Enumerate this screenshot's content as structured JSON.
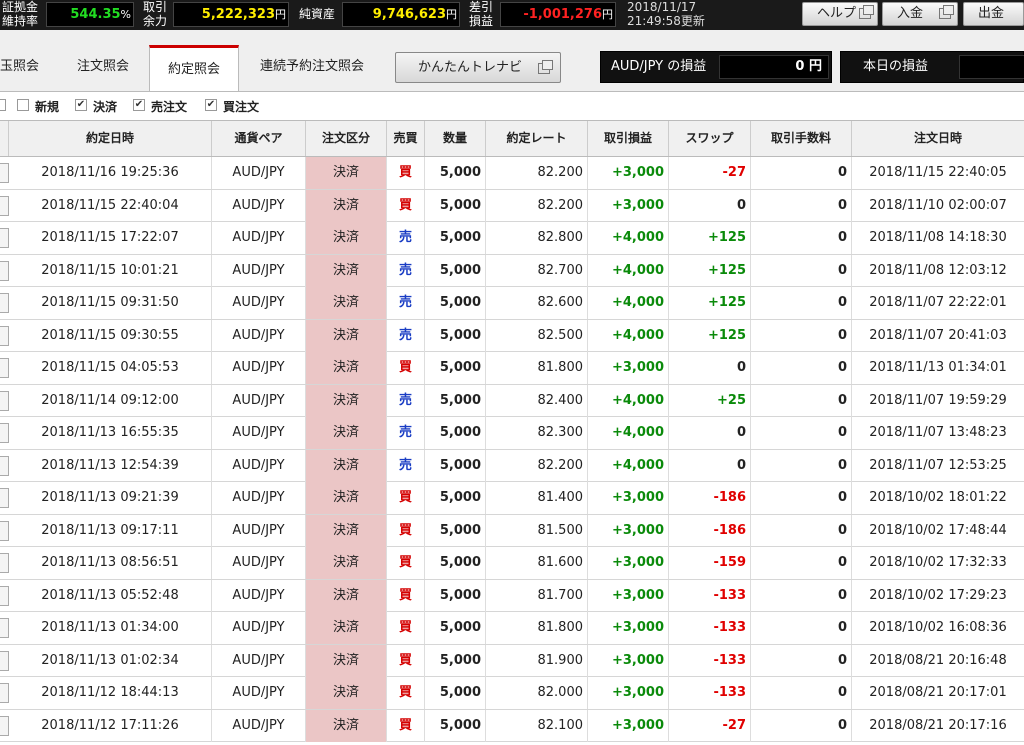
{
  "header": {
    "margin_ratio_label_1": "証拠金",
    "margin_ratio_label_2": "維持率",
    "margin_ratio_value": "544.35",
    "margin_ratio_unit": "%",
    "available_label_1": "取引",
    "available_label_2": "余力",
    "available_value": "5,222,323",
    "available_unit": "円",
    "net_assets_label": "純資産",
    "net_assets_value": "9,746,623",
    "net_assets_unit": "円",
    "diff_pl_label_1": "差引",
    "diff_pl_label_2": "損益",
    "diff_pl_value": "-1,001,276",
    "diff_pl_unit": "円",
    "updated_date": "2018/11/17",
    "updated_time": "21:49:58更新",
    "help_label": "ヘルプ",
    "deposit_label": "入金",
    "withdraw_label": "出金",
    "colors": {
      "positive": "#22dd22",
      "value": "#ffee00",
      "negative": "#ff2222"
    }
  },
  "tabs": [
    {
      "label": "玉照会",
      "active": false
    },
    {
      "label": "注文照会",
      "active": false
    },
    {
      "label": "約定照会",
      "active": true
    },
    {
      "label": "連続予約注文照会",
      "active": false
    }
  ],
  "navi_button": "かんたんトレナビ",
  "pair_pl": {
    "label": "AUD/JPY の損益",
    "value": "0 円"
  },
  "today_pl": {
    "label": "本日の損益",
    "value": ""
  },
  "filters": [
    {
      "label": "新規",
      "checked": false
    },
    {
      "label": "決済",
      "checked": true
    },
    {
      "label": "売注文",
      "checked": true
    },
    {
      "label": "買注文",
      "checked": true
    }
  ],
  "columns": [
    "約定日時",
    "通貨ペア",
    "注文区分",
    "売買",
    "数量",
    "約定レート",
    "取引損益",
    "スワップ",
    "取引手数料",
    "注文日時"
  ],
  "rows": [
    {
      "exec_time": "2018/11/16 19:25:36",
      "pair": "AUD/JPY",
      "kubun": "決済",
      "side": "買",
      "qty": "5,000",
      "rate": "82.200",
      "pl": "+3,000",
      "swap": "-27",
      "fee": "0",
      "order_time": "2018/11/15 22:40:05"
    },
    {
      "exec_time": "2018/11/15 22:40:04",
      "pair": "AUD/JPY",
      "kubun": "決済",
      "side": "買",
      "qty": "5,000",
      "rate": "82.200",
      "pl": "+3,000",
      "swap": "0",
      "fee": "0",
      "order_time": "2018/11/10 02:00:07"
    },
    {
      "exec_time": "2018/11/15 17:22:07",
      "pair": "AUD/JPY",
      "kubun": "決済",
      "side": "売",
      "qty": "5,000",
      "rate": "82.800",
      "pl": "+4,000",
      "swap": "+125",
      "fee": "0",
      "order_time": "2018/11/08 14:18:30"
    },
    {
      "exec_time": "2018/11/15 10:01:21",
      "pair": "AUD/JPY",
      "kubun": "決済",
      "side": "売",
      "qty": "5,000",
      "rate": "82.700",
      "pl": "+4,000",
      "swap": "+125",
      "fee": "0",
      "order_time": "2018/11/08 12:03:12"
    },
    {
      "exec_time": "2018/11/15 09:31:50",
      "pair": "AUD/JPY",
      "kubun": "決済",
      "side": "売",
      "qty": "5,000",
      "rate": "82.600",
      "pl": "+4,000",
      "swap": "+125",
      "fee": "0",
      "order_time": "2018/11/07 22:22:01"
    },
    {
      "exec_time": "2018/11/15 09:30:55",
      "pair": "AUD/JPY",
      "kubun": "決済",
      "side": "売",
      "qty": "5,000",
      "rate": "82.500",
      "pl": "+4,000",
      "swap": "+125",
      "fee": "0",
      "order_time": "2018/11/07 20:41:03"
    },
    {
      "exec_time": "2018/11/15 04:05:53",
      "pair": "AUD/JPY",
      "kubun": "決済",
      "side": "買",
      "qty": "5,000",
      "rate": "81.800",
      "pl": "+3,000",
      "swap": "0",
      "fee": "0",
      "order_time": "2018/11/13 01:34:01"
    },
    {
      "exec_time": "2018/11/14 09:12:00",
      "pair": "AUD/JPY",
      "kubun": "決済",
      "side": "売",
      "qty": "5,000",
      "rate": "82.400",
      "pl": "+4,000",
      "swap": "+25",
      "fee": "0",
      "order_time": "2018/11/07 19:59:29"
    },
    {
      "exec_time": "2018/11/13 16:55:35",
      "pair": "AUD/JPY",
      "kubun": "決済",
      "side": "売",
      "qty": "5,000",
      "rate": "82.300",
      "pl": "+4,000",
      "swap": "0",
      "fee": "0",
      "order_time": "2018/11/07 13:48:23"
    },
    {
      "exec_time": "2018/11/13 12:54:39",
      "pair": "AUD/JPY",
      "kubun": "決済",
      "side": "売",
      "qty": "5,000",
      "rate": "82.200",
      "pl": "+4,000",
      "swap": "0",
      "fee": "0",
      "order_time": "2018/11/07 12:53:25"
    },
    {
      "exec_time": "2018/11/13 09:21:39",
      "pair": "AUD/JPY",
      "kubun": "決済",
      "side": "買",
      "qty": "5,000",
      "rate": "81.400",
      "pl": "+3,000",
      "swap": "-186",
      "fee": "0",
      "order_time": "2018/10/02 18:01:22"
    },
    {
      "exec_time": "2018/11/13 09:17:11",
      "pair": "AUD/JPY",
      "kubun": "決済",
      "side": "買",
      "qty": "5,000",
      "rate": "81.500",
      "pl": "+3,000",
      "swap": "-186",
      "fee": "0",
      "order_time": "2018/10/02 17:48:44"
    },
    {
      "exec_time": "2018/11/13 08:56:51",
      "pair": "AUD/JPY",
      "kubun": "決済",
      "side": "買",
      "qty": "5,000",
      "rate": "81.600",
      "pl": "+3,000",
      "swap": "-159",
      "fee": "0",
      "order_time": "2018/10/02 17:32:33"
    },
    {
      "exec_time": "2018/11/13 05:52:48",
      "pair": "AUD/JPY",
      "kubun": "決済",
      "side": "買",
      "qty": "5,000",
      "rate": "81.700",
      "pl": "+3,000",
      "swap": "-133",
      "fee": "0",
      "order_time": "2018/10/02 17:29:23"
    },
    {
      "exec_time": "2018/11/13 01:34:00",
      "pair": "AUD/JPY",
      "kubun": "決済",
      "side": "買",
      "qty": "5,000",
      "rate": "81.800",
      "pl": "+3,000",
      "swap": "-133",
      "fee": "0",
      "order_time": "2018/10/02 16:08:36"
    },
    {
      "exec_time": "2018/11/13 01:02:34",
      "pair": "AUD/JPY",
      "kubun": "決済",
      "side": "買",
      "qty": "5,000",
      "rate": "81.900",
      "pl": "+3,000",
      "swap": "-133",
      "fee": "0",
      "order_time": "2018/08/21 20:16:48"
    },
    {
      "exec_time": "2018/11/12 18:44:13",
      "pair": "AUD/JPY",
      "kubun": "決済",
      "side": "買",
      "qty": "5,000",
      "rate": "82.000",
      "pl": "+3,000",
      "swap": "-133",
      "fee": "0",
      "order_time": "2018/08/21 20:17:01"
    },
    {
      "exec_time": "2018/11/12 17:11:26",
      "pair": "AUD/JPY",
      "kubun": "決済",
      "side": "買",
      "qty": "5,000",
      "rate": "82.100",
      "pl": "+3,000",
      "swap": "-27",
      "fee": "0",
      "order_time": "2018/08/21 20:17:16"
    }
  ]
}
